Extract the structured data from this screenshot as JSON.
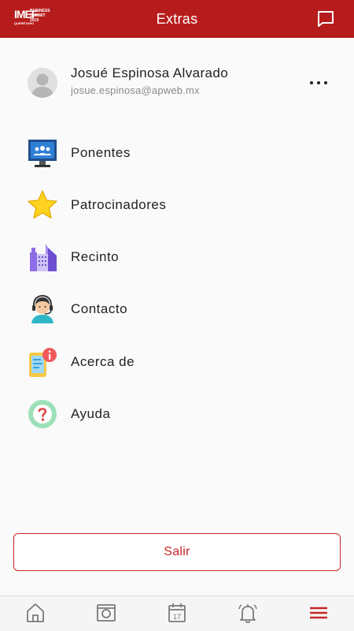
{
  "header": {
    "title": "Extras",
    "logo": {
      "main": "IMEF",
      "sub": "BUSINESS SUMMIT 2019",
      "foot": "QUERÉTARO"
    }
  },
  "profile": {
    "name": "Josué Espinosa Alvarado",
    "email": "josue.espinosa@apweb.mx"
  },
  "menu": [
    {
      "label": "Ponentes",
      "icon": "speakers-screen-icon"
    },
    {
      "label": "Patrocinadores",
      "icon": "star-icon"
    },
    {
      "label": "Recinto",
      "icon": "building-icon"
    },
    {
      "label": "Contacto",
      "icon": "support-agent-icon"
    },
    {
      "label": "Acerca de",
      "icon": "phone-info-icon"
    },
    {
      "label": "Ayuda",
      "icon": "question-icon"
    }
  ],
  "logout": {
    "label": "Salir"
  },
  "bottom_nav": [
    {
      "name": "home",
      "icon": "home-icon",
      "active": false
    },
    {
      "name": "camera",
      "icon": "camera-icon",
      "active": false
    },
    {
      "name": "calendar",
      "icon": "calendar-icon",
      "active": false,
      "day": "17"
    },
    {
      "name": "notifications",
      "icon": "bell-icon",
      "active": false
    },
    {
      "name": "menu",
      "icon": "hamburger-menu-icon",
      "active": true
    }
  ],
  "colors": {
    "brand": "#b71c1c",
    "accent": "#c62828",
    "icon_inactive": "#7a7a7a"
  }
}
